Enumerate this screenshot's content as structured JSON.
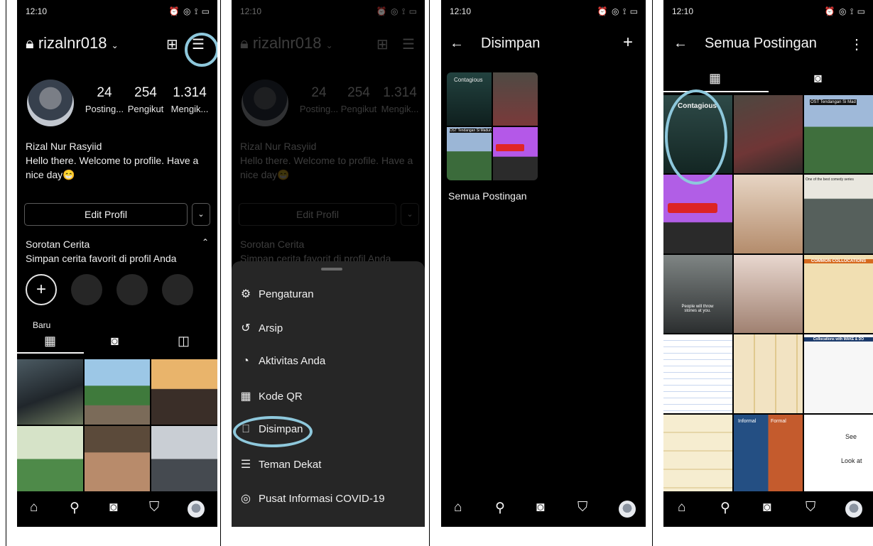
{
  "status": {
    "time": "12:10",
    "icons": "⏰ ◎ ⟟ ▭"
  },
  "screen1": {
    "username": "rizalnr018",
    "stats": [
      {
        "num": "24",
        "label": "Posting..."
      },
      {
        "num": "254",
        "label": "Pengikut"
      },
      {
        "num": "1.314",
        "label": "Mengik..."
      }
    ],
    "full_name": "Rizal Nur Rasyiid",
    "bio": "Hello there. Welcome to profile. Have a nice day😁",
    "edit_label": "Edit Profil",
    "highlights_title": "Sorotan Cerita",
    "highlights_sub": "Simpan cerita favorit di profil Anda",
    "new_label": "Baru"
  },
  "screen2": {
    "menu": [
      {
        "icon": "settings-icon",
        "glyph": "⚙",
        "label": "Pengaturan"
      },
      {
        "icon": "archive-icon",
        "glyph": "↺",
        "label": "Arsip"
      },
      {
        "icon": "activity-icon",
        "glyph": "◔",
        "label": "Aktivitas Anda"
      },
      {
        "icon": "qr-icon",
        "glyph": "▦",
        "label": "Kode QR"
      },
      {
        "icon": "saved-icon",
        "glyph": "⎕",
        "label": "Disimpan"
      },
      {
        "icon": "close-friends-icon",
        "glyph": "☰",
        "label": "Teman Dekat"
      },
      {
        "icon": "covid-info-icon",
        "glyph": "◎",
        "label": "Pusat Informasi COVID-19"
      }
    ]
  },
  "screen3": {
    "title": "Disimpan",
    "collection": "Semua Postingan",
    "thumb_text_1": "Contagious",
    "thumb_text_2": "OST Tendangan Si Madun"
  },
  "screen4": {
    "title": "Semua Postingan",
    "tile_texts": {
      "contagious": "Contagious",
      "ost": "OST Tendangan Si Mad",
      "comedy": "One of the best comedy series",
      "collocations": "COMMON COLLOCATIONS",
      "make_do": "Collocations with MAKE & DO",
      "informal": "Informal",
      "formal": "Formal",
      "see": "See",
      "look_at": "Look at",
      "people_will": "People will throw stones at you."
    }
  },
  "colors": {
    "bg": "#000000",
    "highlight_ring": "#8ec8dc",
    "sheet": "#262626"
  }
}
